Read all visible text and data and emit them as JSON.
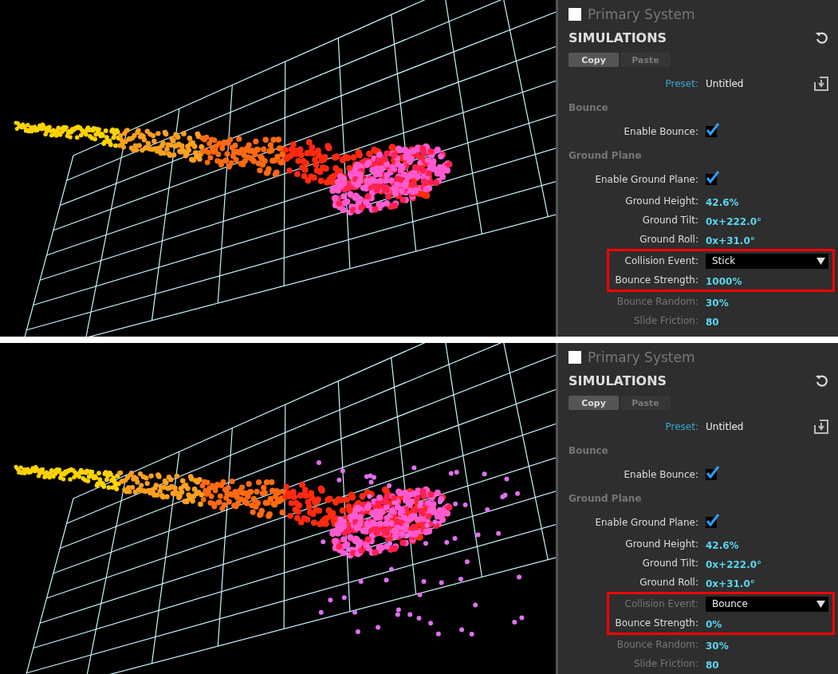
{
  "scenes": [
    {
      "panel": {
        "title": "Primary System",
        "section": "SIMULATIONS",
        "buttons": [
          {
            "label": "Copy",
            "disabled": false
          },
          {
            "label": "Paste",
            "disabled": true
          }
        ],
        "preset": {
          "label": "Preset:",
          "value": "Untitled"
        },
        "groups": [
          {
            "heading": "Bounce",
            "rows": [
              {
                "kind": "checkbox",
                "label": "Enable Bounce:",
                "checked": true,
                "dimmed": false,
                "highlighted": false
              }
            ]
          },
          {
            "heading": "Ground Plane",
            "rows": [
              {
                "kind": "checkbox",
                "label": "Enable Ground Plane:",
                "checked": true,
                "dimmed": false,
                "highlighted": false
              },
              {
                "kind": "value",
                "label": "Ground Height:",
                "value": "42.6%",
                "dimmed": false,
                "highlighted": false
              },
              {
                "kind": "value",
                "label": "Ground Tilt:",
                "value": "0x+222.0°",
                "dimmed": false,
                "highlighted": false
              },
              {
                "kind": "value",
                "label": "Ground Roll:",
                "value": "0x+31.0°",
                "dimmed": false,
                "highlighted": false
              },
              {
                "kind": "dropdown",
                "label": "Collision Event:",
                "value": "Stick",
                "dimmed": false,
                "highlighted": true
              },
              {
                "kind": "value",
                "label": "Bounce Strength:",
                "value": "1000%",
                "dimmed": false,
                "highlighted": true
              },
              {
                "kind": "value",
                "label": "Bounce Random:",
                "value": "30%",
                "dimmed": true,
                "highlighted": false
              },
              {
                "kind": "value",
                "label": "Slide Friction:",
                "value": "80",
                "dimmed": true,
                "highlighted": false
              }
            ]
          }
        ]
      }
    },
    {
      "panel": {
        "title": "Primary System",
        "section": "SIMULATIONS",
        "buttons": [
          {
            "label": "Copy",
            "disabled": false
          },
          {
            "label": "Paste",
            "disabled": true
          }
        ],
        "preset": {
          "label": "Preset:",
          "value": "Untitled"
        },
        "groups": [
          {
            "heading": "Bounce",
            "rows": [
              {
                "kind": "checkbox",
                "label": "Enable Bounce:",
                "checked": true,
                "dimmed": false,
                "highlighted": false
              }
            ]
          },
          {
            "heading": "Ground Plane",
            "rows": [
              {
                "kind": "checkbox",
                "label": "Enable Ground Plane:",
                "checked": true,
                "dimmed": false,
                "highlighted": false
              },
              {
                "kind": "value",
                "label": "Ground Height:",
                "value": "42.6%",
                "dimmed": false,
                "highlighted": false
              },
              {
                "kind": "value",
                "label": "Ground Tilt:",
                "value": "0x+222.0°",
                "dimmed": false,
                "highlighted": false
              },
              {
                "kind": "value",
                "label": "Ground Roll:",
                "value": "0x+31.0°",
                "dimmed": false,
                "highlighted": false
              },
              {
                "kind": "dropdown",
                "label": "Collision Event:",
                "value": "Bounce",
                "dimmed": true,
                "highlighted": true
              },
              {
                "kind": "value",
                "label": "Bounce Strength:",
                "value": "0%",
                "dimmed": false,
                "highlighted": true
              },
              {
                "kind": "value",
                "label": "Bounce Random:",
                "value": "30%",
                "dimmed": true,
                "highlighted": false
              },
              {
                "kind": "value",
                "label": "Slide Friction:",
                "value": "80",
                "dimmed": true,
                "highlighted": false
              }
            ]
          }
        ]
      }
    }
  ]
}
